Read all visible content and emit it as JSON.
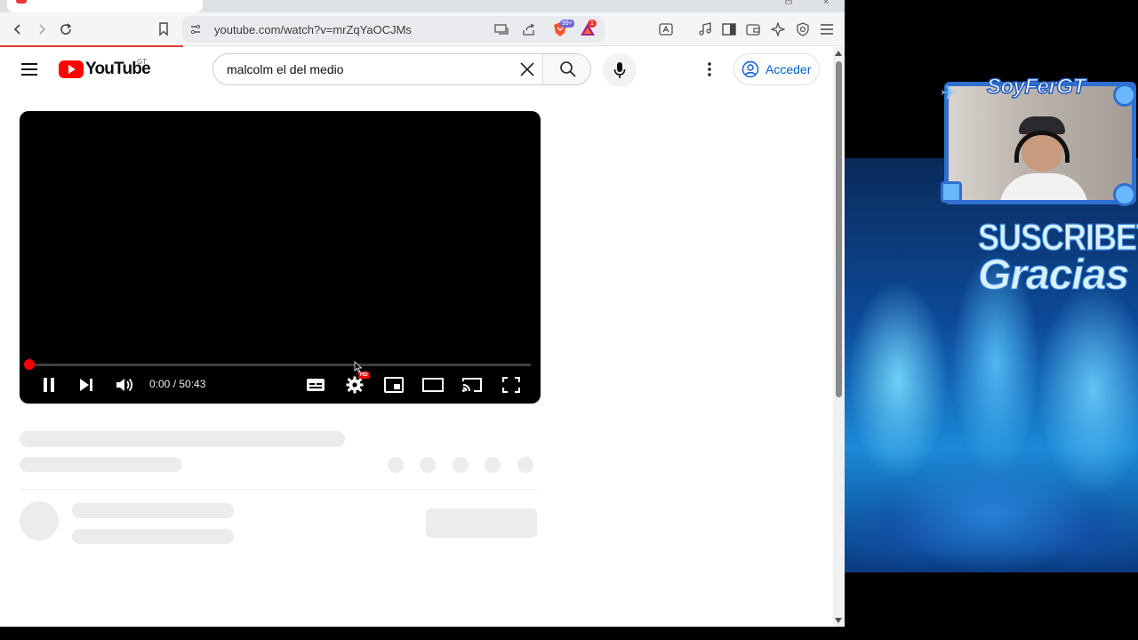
{
  "browser": {
    "url": "youtube.com/watch?v=mrZqYaOCJMs",
    "brave_badge": "99+",
    "rewards_badge": "1"
  },
  "youtube": {
    "logo_text": "YouTube",
    "country_code": "GT",
    "search_value": "malcolm el del medio",
    "signin_label": "Acceder"
  },
  "player": {
    "time": "0:00 / 50:43",
    "hd_label": "HD",
    "progress": 0.0
  },
  "overlay": {
    "channel_name": "SoyFerGT",
    "subscribe_text": "SUSCRIBETE",
    "thanks_text": "Gracias"
  },
  "colors": {
    "youtube_red": "#ff0000",
    "link_blue": "#065fd4",
    "overlay_blue": "#2e6fd0"
  }
}
